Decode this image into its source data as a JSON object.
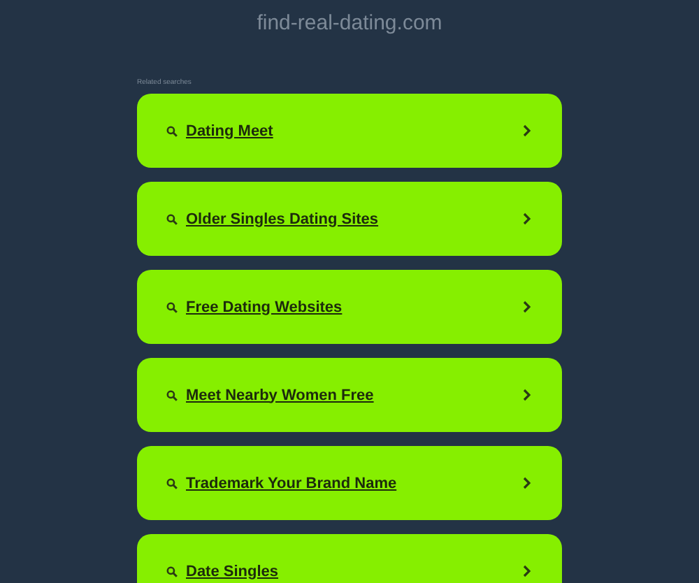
{
  "header": {
    "domain": "find-real-dating.com"
  },
  "section_label": "Related searches",
  "searches": [
    {
      "label": "Dating Meet"
    },
    {
      "label": "Older Singles Dating Sites"
    },
    {
      "label": "Free Dating Websites"
    },
    {
      "label": "Meet Nearby Women Free"
    },
    {
      "label": "Trademark Your Brand Name"
    },
    {
      "label": "Date Singles"
    }
  ]
}
